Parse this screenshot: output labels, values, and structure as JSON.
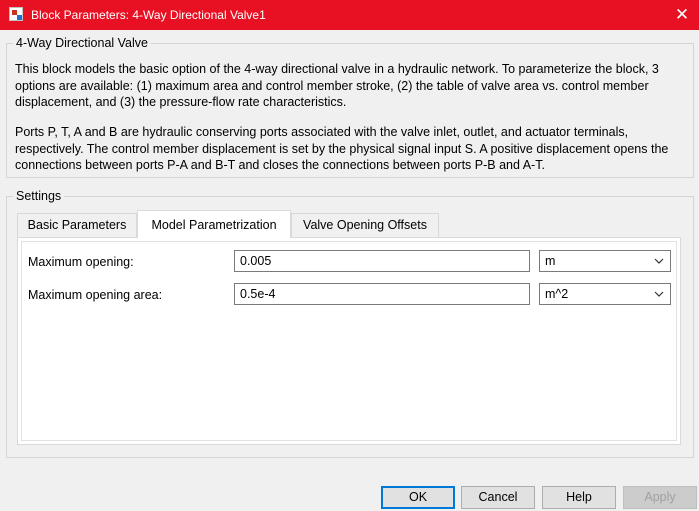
{
  "window": {
    "title": "Block Parameters: 4-Way Directional Valve1",
    "close_glyph": "✕",
    "icon": "simulink-block-icon",
    "accent": "#e81123"
  },
  "description": {
    "legend": "4-Way Directional Valve",
    "paragraph1": "This block models the basic option of the 4-way directional valve in a hydraulic network. To parameterize the block, 3 options are available: (1) maximum area and control member stroke, (2) the table of valve area vs. control member displacement, and (3) the pressure-flow rate characteristics.",
    "paragraph2": "Ports P, T, A and B are hydraulic conserving ports associated with the valve inlet, outlet, and actuator terminals, respectively. The control member displacement is set by the physical signal input S. A positive displacement opens the connections between ports P-A and B-T and closes the connections between ports P-B and A-T."
  },
  "settings": {
    "legend": "Settings",
    "tabs": [
      "Basic Parameters",
      "Model Parametrization",
      "Valve Opening Offsets"
    ],
    "active_tab": "Model Parametrization",
    "fields": [
      {
        "label": "Maximum opening:",
        "value": "0.005",
        "unit": "m"
      },
      {
        "label": "Maximum opening area:",
        "value": "0.5e-4",
        "unit": "m^2"
      }
    ]
  },
  "buttons": {
    "ok": "OK",
    "cancel": "Cancel",
    "help": "Help",
    "apply": "Apply"
  }
}
